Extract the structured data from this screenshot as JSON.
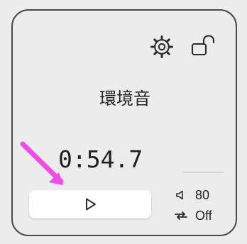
{
  "title": "環境音",
  "timer": "0:54.7",
  "volume": {
    "label": "80",
    "value": 80
  },
  "repeat": {
    "label": "Off"
  },
  "icons": {
    "settings": "gear-icon",
    "lock": "unlocked-lock-icon",
    "play": "play-icon",
    "volume": "speaker-icon",
    "repeat": "repeat-icon",
    "pointer": "arrow-icon"
  },
  "colors": {
    "background": "#ececec",
    "border": "#4a4a4a",
    "text": "#222222",
    "button": "#ffffff",
    "pointer": "#ee4de8"
  }
}
